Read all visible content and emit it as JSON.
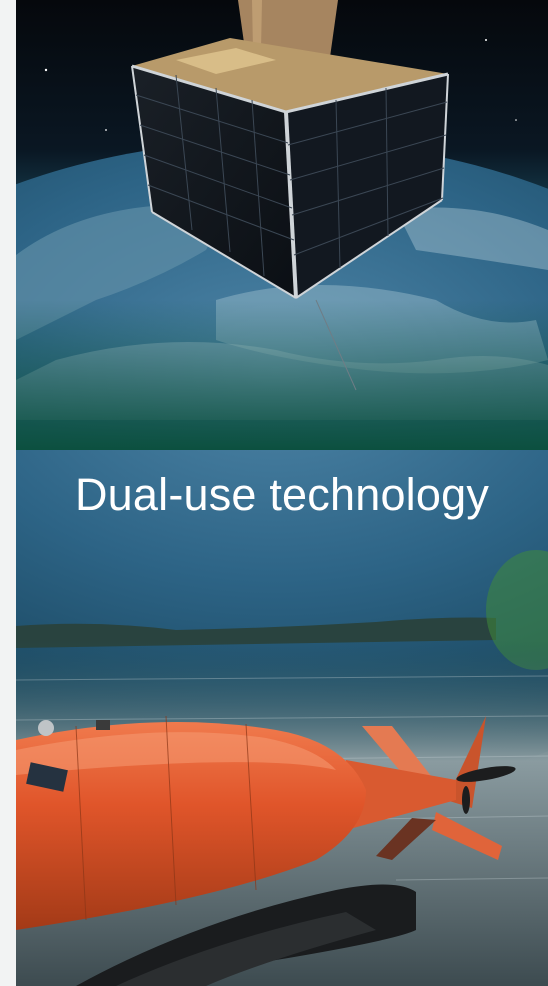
{
  "slide": {
    "title": "Dual-use technology"
  },
  "images": {
    "top": "satellite-over-earth",
    "bottom": "orange-underwater-vehicle-at-sea"
  },
  "colors": {
    "band": "#0c503f",
    "vehicle": "#e0552a",
    "title_text": "#ffffff"
  }
}
